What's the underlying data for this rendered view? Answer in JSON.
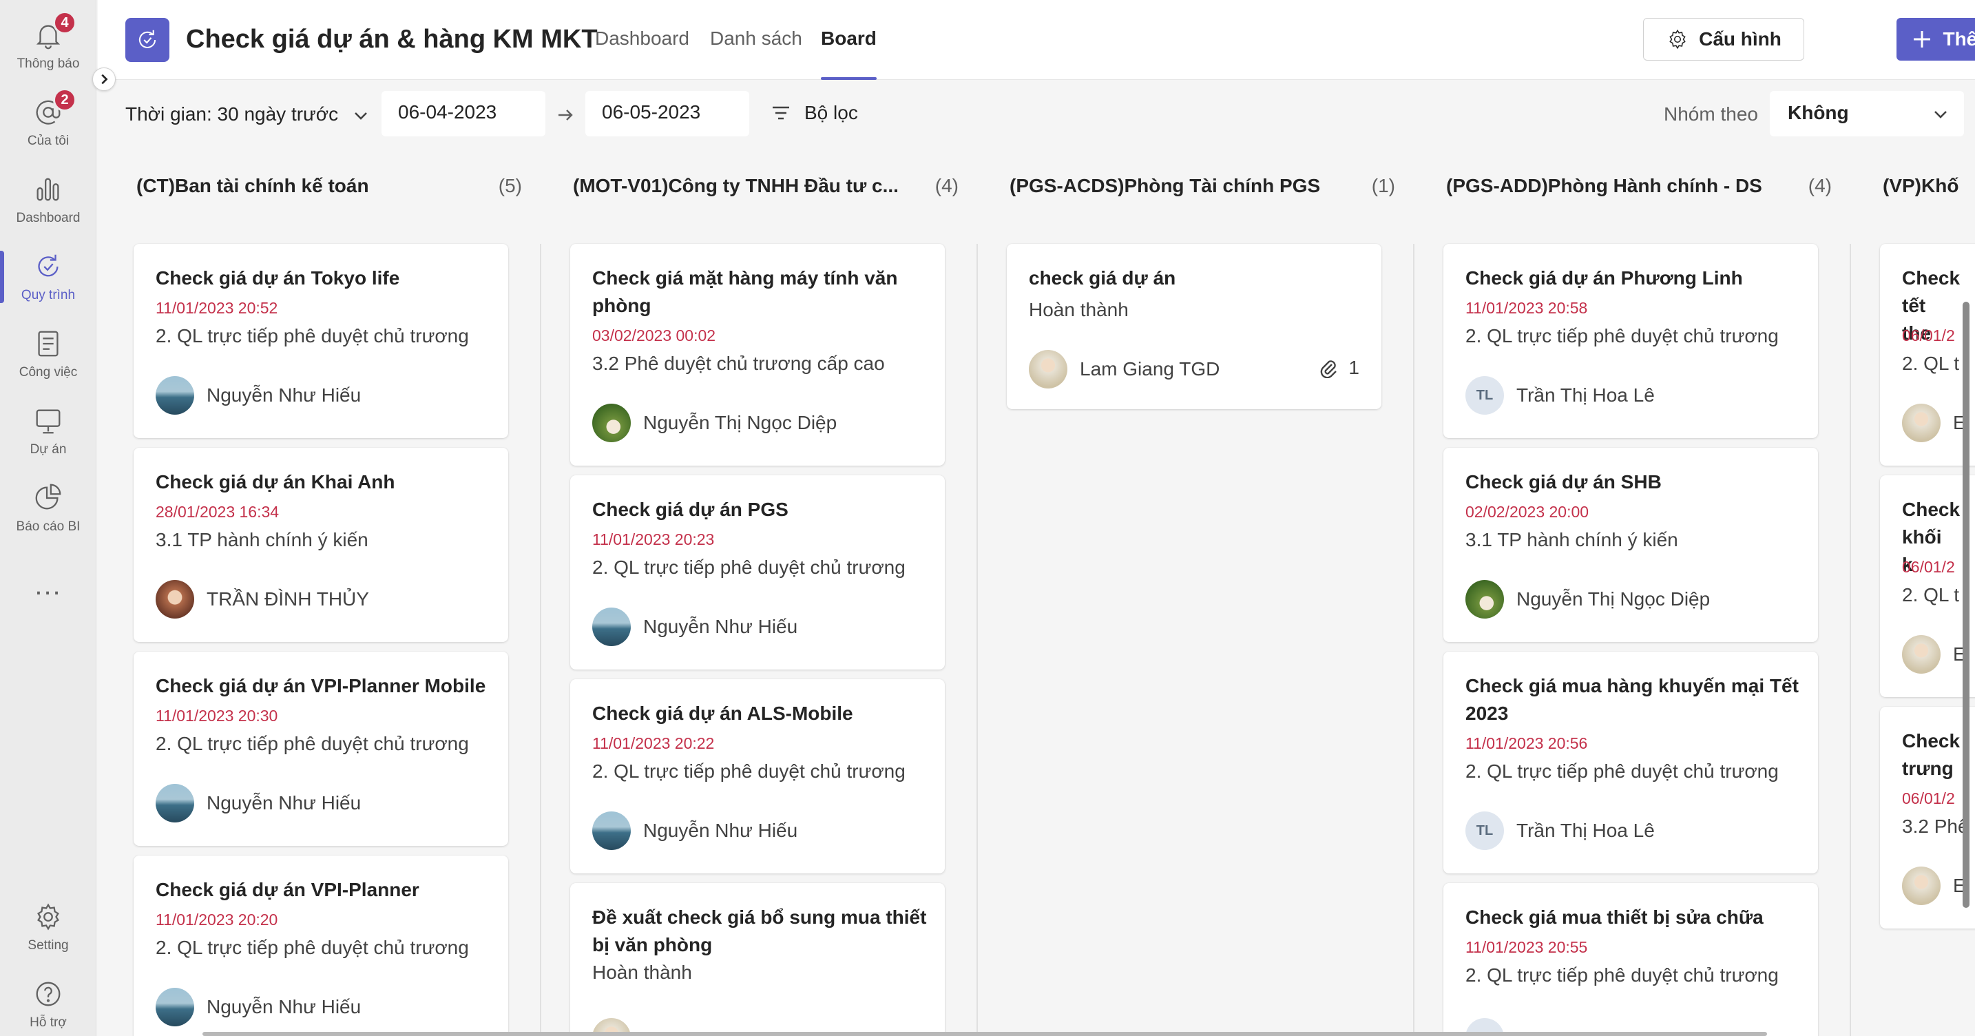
{
  "rail": {
    "notifications": {
      "label": "Thông báo",
      "badge": "4"
    },
    "mine": {
      "label": "Của tôi",
      "badge": "2"
    },
    "dashboard": {
      "label": "Dashboard"
    },
    "process": {
      "label": "Quy trình"
    },
    "work": {
      "label": "Công việc"
    },
    "project": {
      "label": "Dự án"
    },
    "bi": {
      "label": "Báo cáo BI"
    },
    "more": {
      "label": "..."
    },
    "setting": {
      "label": "Setting"
    },
    "help": {
      "label": "Hỗ trợ"
    }
  },
  "header": {
    "title": "Check giá dự án & hàng KM MKT",
    "tabs": [
      "Dashboard",
      "Danh sách",
      "Board"
    ],
    "active_tab": "Board",
    "config_label": "Cấu hình",
    "add_label": "Thêm mới",
    "accent": "#5b5fc7"
  },
  "toolbar": {
    "time_label": "Thời gian: 30 ngày trước",
    "date_from": "06-04-2023",
    "date_to": "06-05-2023",
    "filter_label": "Bộ lọc",
    "group_label": "Nhóm theo",
    "group_value": "Không"
  },
  "columns": [
    {
      "name": "(CT)Ban tài chính kế toán",
      "count": "(5)",
      "cards": [
        {
          "title": "Check giá dự án Tokyo life",
          "date": "11/01/2023 20:52",
          "step": "2. QL trực tiếp phê duyệt chủ trương",
          "user": "Nguyễn Như Hiếu",
          "avatar": "sea"
        },
        {
          "title": "Check giá dự án Khai Anh",
          "date": "28/01/2023 16:34",
          "step": "3.1 TP hành chính ý kiến",
          "user": "TRẦN ĐÌNH THỦY",
          "avatar": "warm"
        },
        {
          "title": "Check giá dự án VPI-Planner Mobile",
          "date": "11/01/2023 20:30",
          "step": "2. QL trực tiếp phê duyệt chủ trương",
          "user": "Nguyễn Như Hiếu",
          "avatar": "sea"
        },
        {
          "title": "Check giá dự án VPI-Planner",
          "date": "11/01/2023 20:20",
          "step": "2. QL trực tiếp phê duyệt chủ trương",
          "user": "Nguyễn Như Hiếu",
          "avatar": "sea"
        }
      ]
    },
    {
      "name": "(MOT-V01)Công ty TNHH Đầu tư c...",
      "count": "(4)",
      "cards": [
        {
          "title": "Check giá mặt hàng máy tính văn phòng",
          "date": "03/02/2023 00:02",
          "step": "3.2 Phê duyệt chủ trương cấp cao",
          "user": "Nguyễn Thị Ngọc Diệp",
          "avatar": "leaf"
        },
        {
          "title": "Check giá dự án PGS",
          "date": "11/01/2023 20:23",
          "step": "2. QL trực tiếp phê duyệt chủ trương",
          "user": "Nguyễn Như Hiếu",
          "avatar": "sea"
        },
        {
          "title": "Check giá dự án ALS-Mobile",
          "date": "11/01/2023 20:22",
          "step": "2. QL trực tiếp phê duyệt chủ trương",
          "user": "Nguyễn Như Hiếu",
          "avatar": "sea"
        },
        {
          "title": "Đề xuất check giá bổ sung mua thiết bị văn phòng",
          "date": "",
          "step": "Hoàn thành",
          "user": "",
          "avatar": "person"
        }
      ]
    },
    {
      "name": "(PGS-ACDS)Phòng Tài chính PGS",
      "count": "(1)",
      "cards": [
        {
          "title": "check giá dự án",
          "date": "",
          "step": "Hoàn thành",
          "user": "Lam Giang TGD",
          "avatar": "person",
          "attachments": "1"
        }
      ]
    },
    {
      "name": "(PGS-ADD)Phòng Hành chính - DS",
      "count": "(4)",
      "cards": [
        {
          "title": "Check giá dự án Phương Linh",
          "date": "11/01/2023 20:58",
          "step": "2. QL trực tiếp phê duyệt chủ trương",
          "user": "Trần Thị Hoa Lê",
          "avatar": "initials",
          "initials": "TL"
        },
        {
          "title": "Check giá dự án SHB",
          "date": "02/02/2023 20:00",
          "step": "3.1 TP hành chính ý kiến",
          "user": "Nguyễn Thị Ngọc Diệp",
          "avatar": "leaf"
        },
        {
          "title": "Check giá mua hàng khuyến mại Tết 2023",
          "date": "11/01/2023 20:56",
          "step": "2. QL trực tiếp phê duyệt chủ trương",
          "user": "Trần Thị Hoa Lê",
          "avatar": "initials",
          "initials": "TL"
        },
        {
          "title": "Check giá mua thiết bị sửa chữa",
          "date": "11/01/2023 20:55",
          "step": "2. QL trực tiếp phê duyệt chủ trương",
          "user": "",
          "avatar": "initials",
          "initials": ""
        }
      ]
    },
    {
      "name": "(VP)Khố",
      "count": "",
      "cards": [
        {
          "title": "Check tết the",
          "date": "06/01/2",
          "step": "2. QL t",
          "user": "E",
          "avatar": "person"
        },
        {
          "title": "Check khối k",
          "date": "06/01/2",
          "step": "2. QL t",
          "user": "E",
          "avatar": "person"
        },
        {
          "title": "Check trưng",
          "date": "06/01/2",
          "step": "3.2 Phê",
          "user": "E",
          "avatar": "person"
        }
      ]
    }
  ]
}
